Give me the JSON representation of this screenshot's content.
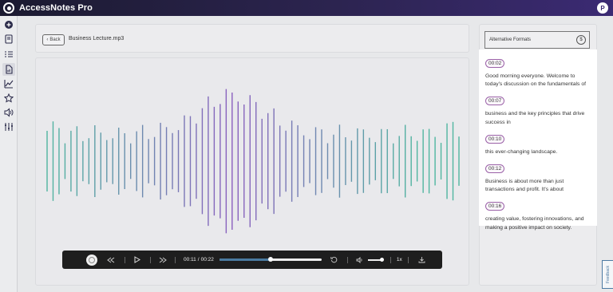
{
  "app": {
    "title": "AccessNotes Pro",
    "user_initial": "P",
    "accent": "#3b2a73"
  },
  "sidebar": {
    "items": [
      {
        "icon": "add-circle-icon"
      },
      {
        "icon": "notebook-icon"
      },
      {
        "icon": "list-icon"
      },
      {
        "icon": "audio-file-icon"
      },
      {
        "icon": "chart-icon"
      },
      {
        "icon": "star-icon"
      },
      {
        "icon": "speaker-icon"
      },
      {
        "icon": "sliders-icon"
      }
    ]
  },
  "header": {
    "back_label": "Back",
    "file_name": "Business Lecture.mp3"
  },
  "player": {
    "current_time": "00:11",
    "separator": "/",
    "duration": "00:22",
    "progress": 0.5,
    "volume": 1.0,
    "speed_label": "1x"
  },
  "alt_formats": {
    "label": "Alternative Formats"
  },
  "transcript": [
    {
      "time": "00:02",
      "text": "Good morning everyone. Welcome to today's discussion on the fundamentals of"
    },
    {
      "time": "00:07",
      "text": "business and the key principles that drive success in"
    },
    {
      "time": "00:10",
      "text": "this ever-changing landscape."
    },
    {
      "time": "00:12",
      "text": "Business is about more than just transactions and profit. It's about"
    },
    {
      "time": "00:16",
      "text": "creating value, fostering innovations, and making a positive impact on society."
    }
  ],
  "feedback_label": "Feedback",
  "waveform": {
    "colors": [
      "#4fb5a0",
      "#8a5fbf"
    ]
  }
}
